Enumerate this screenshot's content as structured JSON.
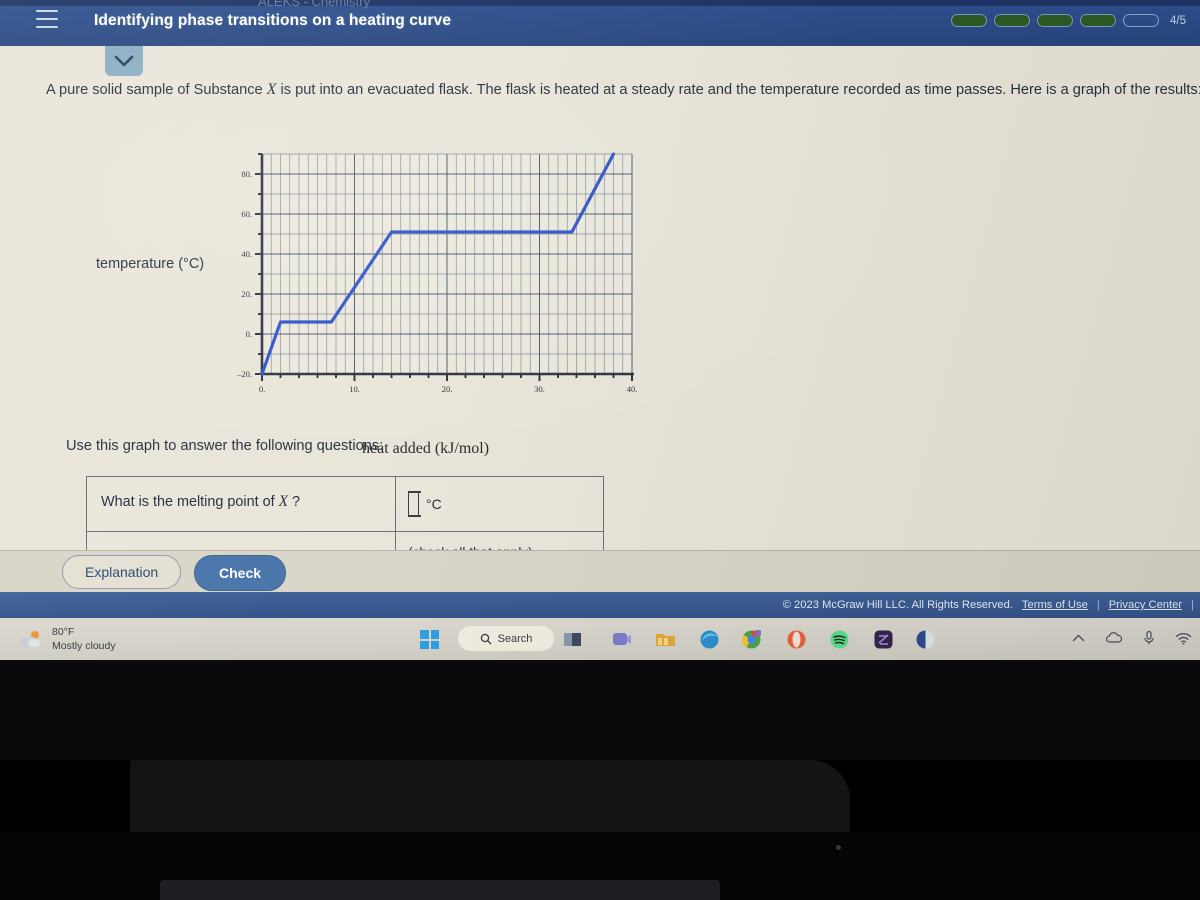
{
  "header": {
    "title": "Identifying phase transitions on a heating curve",
    "ghost_title": "ALEKS - Chemistry",
    "menu_icon": "hamburger-icon",
    "progress_label": "4/5",
    "progress_total": 5,
    "progress_filled": 4,
    "accent_color": "#2c4e8a",
    "progress_fill_color": "#2e5a23"
  },
  "content": {
    "dropdown_icon": "chevron-down-icon",
    "prompt_part1": "A pure solid sample of Substance ",
    "prompt_var": "X",
    "prompt_part2": " is put into an evacuated flask. The flask is heated at a steady rate and the temperature recorded as time passes. Here is a graph of the results:",
    "use_graph_text": "Use this graph to answer the following questions:"
  },
  "chart_data": {
    "type": "line",
    "title": "",
    "xlabel": "heat added (kJ/mol)",
    "ylabel": "temperature (°C)",
    "xlim": [
      0,
      40
    ],
    "ylim": [
      -20,
      90
    ],
    "xticks": [
      0,
      10,
      20,
      30,
      40
    ],
    "xtick_labels": [
      "0.",
      "10.",
      "20.",
      "30.",
      "40."
    ],
    "yticks": [
      -20,
      0,
      20,
      40,
      60,
      80
    ],
    "ytick_labels": [
      "–20.",
      "0.",
      "20.",
      "40.",
      "60.",
      "80."
    ],
    "x_minor_step": 1,
    "y_minor_step": 10,
    "grid": true,
    "grid_color": "#5a6a86",
    "legend": "none",
    "series": [
      {
        "name": "heating curve",
        "color": "#2f52c8",
        "x": [
          0,
          2,
          7.5,
          14,
          33.5,
          38
        ],
        "y": [
          -20,
          6,
          6,
          51,
          51,
          90
        ]
      }
    ],
    "annotations": {
      "melting_plateau_temp": 6,
      "boiling_plateau_temp": 51
    }
  },
  "question_table": {
    "rows": [
      {
        "question_prefix": "What is the melting point of ",
        "question_var": "X",
        "question_suffix": " ?",
        "answer_value": "",
        "answer_unit": "°C",
        "answer_hint": ""
      },
      {
        "question_prefix": "",
        "question_var": "",
        "question_suffix": "",
        "answer_value": "",
        "answer_unit": "",
        "answer_hint": "(check all that apply)"
      }
    ]
  },
  "buttons": {
    "explanation_label": "Explanation",
    "check_label": "Check",
    "check_bg": "#4a76aa"
  },
  "footer": {
    "copyright": "© 2023 McGraw Hill LLC. All Rights Reserved.",
    "terms_label": "Terms of Use",
    "sep1": "|",
    "privacy_label": "Privacy Center",
    "sep2": "|"
  },
  "taskbar": {
    "weather_temp": "80°F",
    "weather_desc": "Mostly cloudy",
    "weather_icon": "partly-cloudy-icon",
    "start_icon": "windows-logo-icon",
    "search_label": "Search",
    "search_icon": "search-icon",
    "apps": [
      {
        "name": "file-explorer-icon",
        "color": "#3f3f6e"
      },
      {
        "name": "teams-icon",
        "color": "#6264a7"
      },
      {
        "name": "folder-icon",
        "color": "#e0a93a"
      },
      {
        "name": "edge-icon",
        "color": "#2b8fd0"
      },
      {
        "name": "chrome-icon",
        "color": "#4285f4"
      },
      {
        "name": "opera-icon",
        "color": "#e8603c"
      },
      {
        "name": "spotify-icon",
        "color": "#1db954"
      },
      {
        "name": "notes-icon",
        "color": "#3b2a5a"
      },
      {
        "name": "app-icon",
        "color": "#2c4c8c"
      }
    ],
    "tray": [
      {
        "name": "chevron-up-icon"
      },
      {
        "name": "onedrive-cloud-icon"
      },
      {
        "name": "microphone-icon"
      },
      {
        "name": "wifi-icon"
      }
    ]
  }
}
